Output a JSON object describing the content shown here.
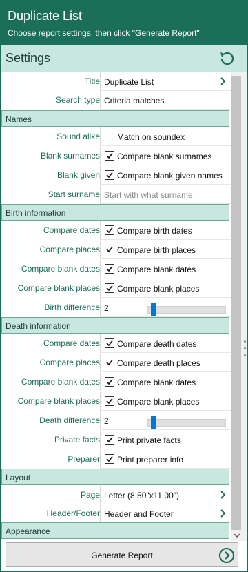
{
  "header": {
    "title": "Duplicate List",
    "subtitle": "Choose report settings, then click \"Generate Report\""
  },
  "settings": {
    "label": "Settings",
    "reset_icon": "reset-arrow-icon"
  },
  "general": {
    "title_label": "Title",
    "title_value": "Duplicate List",
    "search_type_label": "Search type",
    "search_type_value": "Criteria matches"
  },
  "names": {
    "section": "Names",
    "sound_alike_label": "Sound alike",
    "sound_alike_text": "Match on soundex",
    "sound_alike_checked": false,
    "blank_surnames_label": "Blank surnames",
    "blank_surnames_text": "Compare blank surnames",
    "blank_surnames_checked": true,
    "blank_given_label": "Blank given",
    "blank_given_text": "Compare blank given names",
    "blank_given_checked": true,
    "start_surname_label": "Start surname",
    "start_surname_placeholder": "Start with what surname"
  },
  "birth": {
    "section": "Birth information",
    "compare_dates_label": "Compare dates",
    "compare_dates_text": "Compare birth dates",
    "compare_places_label": "Compare places",
    "compare_places_text": "Compare birth places",
    "blank_dates_label": "Compare blank dates",
    "blank_dates_text": "Compare blank dates",
    "blank_places_label": "Compare blank places",
    "blank_places_text": "Compare blank places",
    "difference_label": "Birth difference",
    "difference_value": "2"
  },
  "death": {
    "section": "Death information",
    "compare_dates_label": "Compare dates",
    "compare_dates_text": "Compare death dates",
    "compare_places_label": "Compare places",
    "compare_places_text": "Compare death places",
    "blank_dates_label": "Compare blank dates",
    "blank_dates_text": "Compare blank dates",
    "blank_places_label": "Compare blank places",
    "blank_places_text": "Compare blank places",
    "difference_label": "Death difference",
    "difference_value": "2"
  },
  "other": {
    "private_facts_label": "Private facts",
    "private_facts_text": "Print private facts",
    "preparer_label": "Preparer",
    "preparer_text": "Print preparer info"
  },
  "layout": {
    "section": "Layout",
    "page_label": "Page",
    "page_value": "Letter (8.50\"x11.00\")",
    "header_footer_label": "Header/Footer",
    "header_footer_value": "Header and Footer"
  },
  "appearance": {
    "section": "Appearance"
  },
  "footer": {
    "generate_label": "Generate Report",
    "generate_icon": "go-arrow-circle-icon"
  },
  "colors": {
    "brand": "#1b6e5a",
    "section_bg": "#c8e7df",
    "label_text": "#1f6e5c",
    "slider_thumb": "#0078d7"
  }
}
